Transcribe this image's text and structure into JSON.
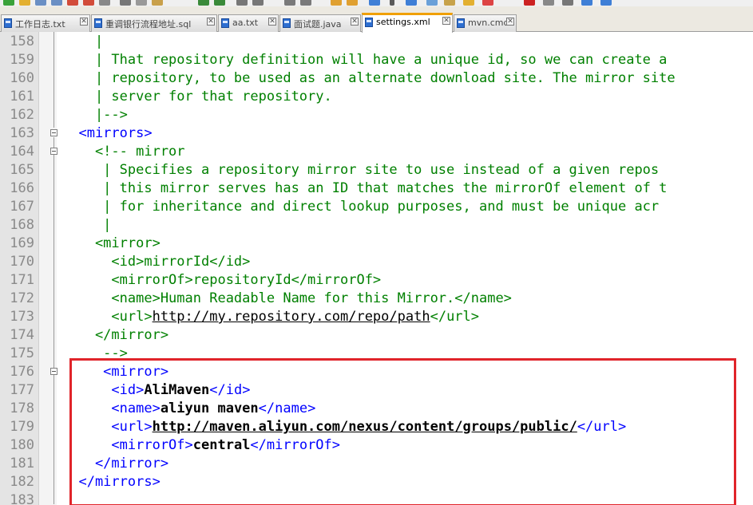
{
  "tabs": [
    {
      "label": "工作日志.txt"
    },
    {
      "label": "重调银行流程地址.sql"
    },
    {
      "label": "aa.txt"
    },
    {
      "label": "面试题.java"
    },
    {
      "label": "settings.xml",
      "active": true
    },
    {
      "label": "mvn.cmd"
    }
  ],
  "colors": {
    "comment": "#008000",
    "tag": "#0000ff",
    "text": "#000000",
    "highlight_border": "#e0242a",
    "active_tab_accent": "#f0a000"
  },
  "editor": {
    "lines": [
      {
        "num": "158",
        "parts": [
          {
            "t": "comment",
            "s": "    |"
          }
        ]
      },
      {
        "num": "159",
        "parts": [
          {
            "t": "comment",
            "s": "    | That repository definition will have a unique id, so we can create a"
          }
        ]
      },
      {
        "num": "160",
        "parts": [
          {
            "t": "comment",
            "s": "    | repository, to be used as an alternate download site. The mirror site"
          }
        ]
      },
      {
        "num": "161",
        "parts": [
          {
            "t": "comment",
            "s": "    | server for that repository."
          }
        ]
      },
      {
        "num": "162",
        "parts": [
          {
            "t": "comment",
            "s": "    |-->"
          }
        ]
      },
      {
        "num": "163",
        "fold": true,
        "parts": [
          {
            "t": "tag",
            "s": "  <mirrors>"
          }
        ]
      },
      {
        "num": "164",
        "fold": true,
        "parts": [
          {
            "t": "comment",
            "s": "    <!-- mirror"
          }
        ]
      },
      {
        "num": "165",
        "parts": [
          {
            "t": "comment",
            "s": "     | Specifies a repository mirror site to use instead of a given repos"
          }
        ]
      },
      {
        "num": "166",
        "parts": [
          {
            "t": "comment",
            "s": "     | this mirror serves has an ID that matches the mirrorOf element of t"
          }
        ]
      },
      {
        "num": "167",
        "parts": [
          {
            "t": "comment",
            "s": "     | for inheritance and direct lookup purposes, and must be unique acr"
          }
        ]
      },
      {
        "num": "168",
        "parts": [
          {
            "t": "comment",
            "s": "     |"
          }
        ]
      },
      {
        "num": "169",
        "parts": [
          {
            "t": "comment",
            "s": "    <mirror>"
          }
        ]
      },
      {
        "num": "170",
        "parts": [
          {
            "t": "comment",
            "s": "      <id>mirrorId</id>"
          }
        ]
      },
      {
        "num": "171",
        "parts": [
          {
            "t": "comment",
            "s": "      <mirrorOf>repositoryId</mirrorOf>"
          }
        ]
      },
      {
        "num": "172",
        "parts": [
          {
            "t": "comment",
            "s": "      <name>Human Readable Name for this Mirror.</name>"
          }
        ]
      },
      {
        "num": "173",
        "parts": [
          {
            "t": "comment",
            "s": "      <url>"
          },
          {
            "t": "comment-url",
            "s": "http://my.repository.com/repo/path"
          },
          {
            "t": "comment",
            "s": "</url>"
          }
        ]
      },
      {
        "num": "174",
        "parts": [
          {
            "t": "comment",
            "s": "    </mirror>"
          }
        ]
      },
      {
        "num": "175",
        "parts": [
          {
            "t": "comment",
            "s": "     -->"
          }
        ]
      },
      {
        "num": "176",
        "fold": true,
        "parts": [
          {
            "t": "tag",
            "s": "     <mirror>"
          }
        ]
      },
      {
        "num": "177",
        "parts": [
          {
            "t": "tag",
            "s": "      <id>"
          },
          {
            "t": "bold",
            "s": "AliMaven"
          },
          {
            "t": "tag",
            "s": "</id>"
          }
        ]
      },
      {
        "num": "178",
        "parts": [
          {
            "t": "tag",
            "s": "      <name>"
          },
          {
            "t": "bold",
            "s": "aliyun maven"
          },
          {
            "t": "tag",
            "s": "</name>"
          }
        ]
      },
      {
        "num": "179",
        "parts": [
          {
            "t": "tag",
            "s": "      <url>"
          },
          {
            "t": "url-bold",
            "s": "http://maven.aliyun.com/nexus/content/groups/public/"
          },
          {
            "t": "tag",
            "s": "</url>"
          }
        ]
      },
      {
        "num": "180",
        "parts": [
          {
            "t": "tag",
            "s": "      <mirrorOf>"
          },
          {
            "t": "bold",
            "s": "central"
          },
          {
            "t": "tag",
            "s": "</mirrorOf>"
          }
        ]
      },
      {
        "num": "181",
        "parts": [
          {
            "t": "tag",
            "s": "    </mirror>"
          }
        ]
      },
      {
        "num": "182",
        "parts": [
          {
            "t": "tag",
            "s": "  </mirrors>"
          }
        ]
      },
      {
        "num": "183",
        "parts": []
      }
    ]
  }
}
